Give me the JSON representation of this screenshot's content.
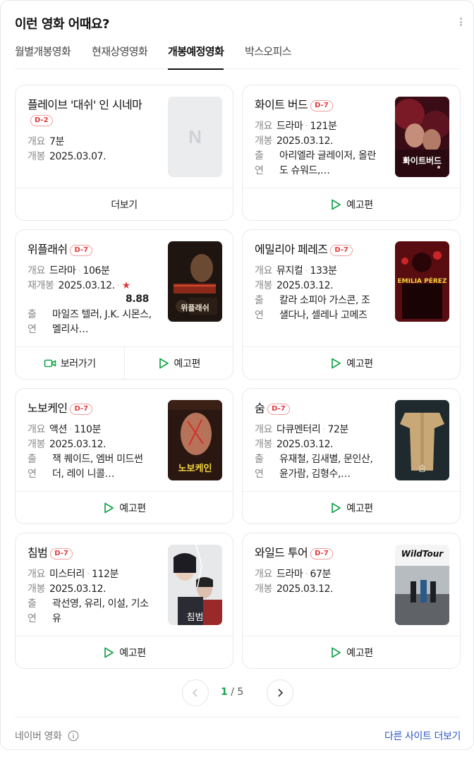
{
  "header": {
    "title": "이런 영화 어때요?"
  },
  "tabs": [
    {
      "label": "월별개봉영화"
    },
    {
      "label": "현재상영영화"
    },
    {
      "label": "개봉예정영화"
    },
    {
      "label": "박스오피스"
    }
  ],
  "labels": {
    "runtime": "개요",
    "release": "개봉",
    "rerelease": "재개봉",
    "cast": "출연",
    "more": "더보기",
    "trailer": "예고편",
    "watch": "보러가기"
  },
  "movies": [
    {
      "title": "플레이브 '대쉬' 인 시네마",
      "badge": "D-2",
      "genre": "",
      "runtime": "7분",
      "release": "2025.03.07.",
      "cast": "",
      "poster_placeholder": "N"
    },
    {
      "title": "화이트 버드",
      "badge": "D-7",
      "genre": "드라마",
      "runtime": "121분",
      "release": "2025.03.12.",
      "cast": "아리엘라 글레이저, 올란도 슈워드,…",
      "poster_text": "화이트버드"
    },
    {
      "title": "위플래쉬",
      "badge": "D-7",
      "genre": "드라마",
      "runtime": "106분",
      "release": "2025.03.12.",
      "rating": "8.88",
      "cast": "마일즈 텔러, J.K. 시몬스, 멜리사…",
      "poster_text": "위플래쉬"
    },
    {
      "title": "에밀리아 페레즈",
      "badge": "D-7",
      "genre": "뮤지컬",
      "runtime": "133분",
      "release": "2025.03.12.",
      "cast": "칼라 소피아 가스콘, 조 샐다나, 셀레나 고메즈",
      "poster_text": "EMILIA PÉREZ"
    },
    {
      "title": "노보케인",
      "badge": "D-7",
      "genre": "액션",
      "runtime": "110분",
      "release": "2025.03.12.",
      "cast": "잭 퀘이드, 엠버 미드썬더, 레이 니콜…",
      "poster_text": "노보케인"
    },
    {
      "title": "숨",
      "badge": "D-7",
      "genre": "다큐멘터리",
      "runtime": "72분",
      "release": "2025.03.12.",
      "cast": "유재철, 김새별, 문인산, 윤가람, 김형수,…",
      "poster_text": "숨"
    },
    {
      "title": "침범",
      "badge": "D-7",
      "genre": "미스터리",
      "runtime": "112분",
      "release": "2025.03.12.",
      "cast": "곽선영, 유리, 이설, 기소유",
      "poster_text": "침범"
    },
    {
      "title": "와일드 투어",
      "badge": "D-7",
      "genre": "드라마",
      "runtime": "67분",
      "release": "2025.03.12.",
      "cast": "",
      "poster_text": "WildTour"
    }
  ],
  "pagination": {
    "current": "1",
    "separator": "/",
    "total": "5"
  },
  "footer": {
    "source": "네이버 영화",
    "other_sites": "다른 사이트 더보기"
  },
  "colors": {
    "accent_green": "#16a34a",
    "badge_red": "#e5393b",
    "link_blue": "#2a56c6"
  }
}
